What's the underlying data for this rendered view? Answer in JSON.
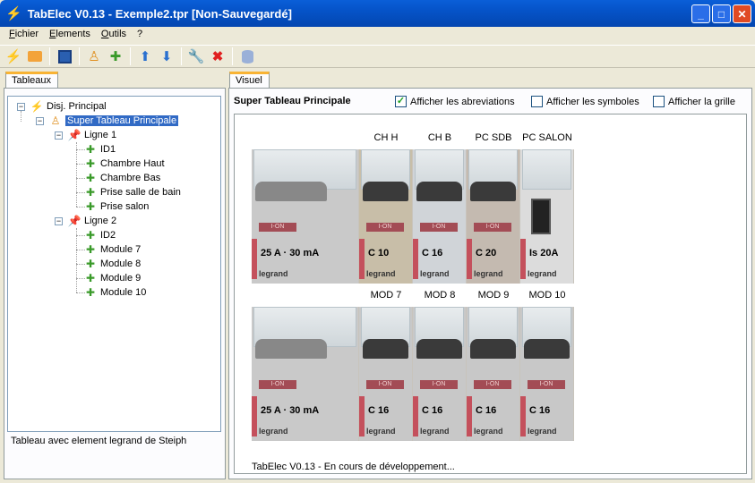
{
  "window": {
    "title": "TabElec V0.13 - Exemple2.tpr [Non-Sauvegardé]"
  },
  "menu": [
    "Fichier",
    "Elements",
    "Outils",
    "?"
  ],
  "toolbar": [
    "new-icon",
    "open-folder-icon",
    "save-icon",
    "tableau-icon",
    "element-icon",
    "move-up-icon",
    "move-down-icon",
    "properties-icon",
    "delete-icon",
    "database-icon"
  ],
  "left": {
    "tab": "Tableaux",
    "status": "Tableau avec element legrand de Steiph",
    "tree": {
      "root": "Disj. Principal",
      "tableau": "Super Tableau Principale",
      "lignes": [
        {
          "label": "Ligne 1",
          "items": [
            "ID1",
            "Chambre Haut",
            "Chambre Bas",
            "Prise salle de bain",
            "Prise salon"
          ]
        },
        {
          "label": "Ligne 2",
          "items": [
            "ID2",
            "Module 7",
            "Module 8",
            "Module 9",
            "Module 10"
          ]
        }
      ]
    }
  },
  "right": {
    "tab": "Visuel",
    "title": "Super Tableau Principale",
    "options": [
      {
        "label": "Afficher les abreviations",
        "checked": true
      },
      {
        "label": "Afficher les symboles",
        "checked": false
      },
      {
        "label": "Afficher la grille",
        "checked": false
      }
    ],
    "rows": [
      {
        "modules": [
          {
            "label": "",
            "rating": "25 A · 30 mA",
            "type": "diff"
          },
          {
            "label": "CH H",
            "rating": "C 10"
          },
          {
            "label": "CH B",
            "rating": "C 16"
          },
          {
            "label": "PC SDB",
            "rating": "C 20"
          },
          {
            "label": "PC SALON",
            "rating": "Is 20A",
            "type": "switch"
          }
        ]
      },
      {
        "modules": [
          {
            "label": "",
            "rating": "25 A · 30 mA",
            "type": "diff"
          },
          {
            "label": "MOD 7",
            "rating": "C 16"
          },
          {
            "label": "MOD 8",
            "rating": "C 16"
          },
          {
            "label": "MOD 9",
            "rating": "C 16"
          },
          {
            "label": "MOD 10",
            "rating": "C 16"
          }
        ]
      }
    ],
    "brand": "legrand",
    "on_label": "I-ON",
    "footer": "TabElec V0.13 - En cours de développement..."
  }
}
